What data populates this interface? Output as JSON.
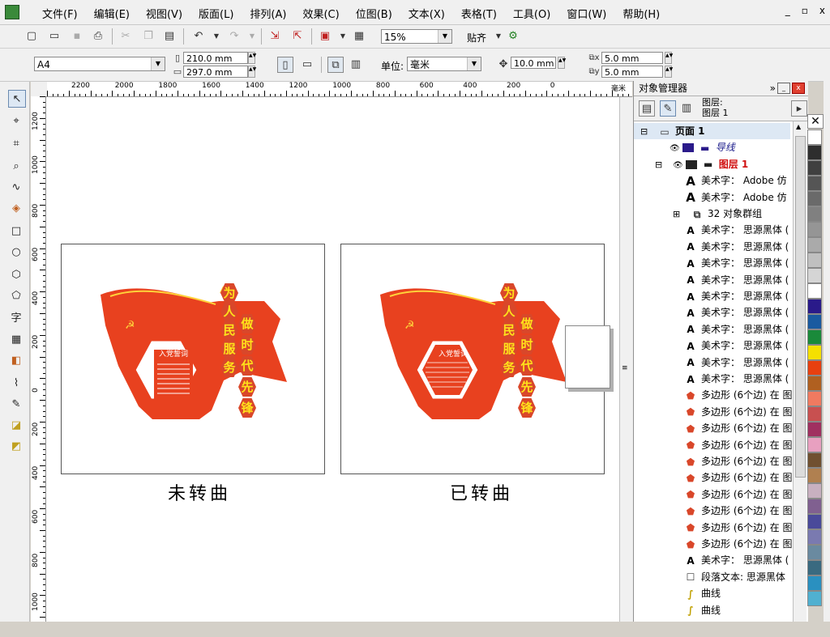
{
  "menubar": {
    "items": [
      "文件(F)",
      "编辑(E)",
      "视图(V)",
      "版面(L)",
      "排列(A)",
      "效果(C)",
      "位图(B)",
      "文本(X)",
      "表格(T)",
      "工具(O)",
      "窗口(W)",
      "帮助(H)"
    ],
    "controls": [
      "_",
      "▫",
      "x"
    ]
  },
  "toolbar": {
    "zoom": "15%",
    "snap": "贴齐"
  },
  "property_bar": {
    "page_size": "A4",
    "width": "210.0 mm",
    "height": "297.0 mm",
    "unit_label": "单位:",
    "unit": "毫米",
    "nudge": "10.0 mm",
    "dup_x": "5.0 mm",
    "dup_y": "5.0 mm",
    "x_label": "x",
    "y_label": "y"
  },
  "ruler": {
    "h_ticks": [
      "2200",
      "2000",
      "1800",
      "1600",
      "1400",
      "1200",
      "1000",
      "800",
      "600",
      "400",
      "200",
      "0"
    ],
    "h_unit": "毫米",
    "v_ticks": [
      "1200",
      "1000",
      "800",
      "600",
      "400",
      "200",
      "0",
      "200",
      "400",
      "600",
      "800",
      "1000"
    ]
  },
  "canvas": {
    "left_panel": {
      "caption": "未转曲",
      "vertical_left": [
        "为",
        "人",
        "民",
        "服",
        "务"
      ],
      "vertical_right": [
        "做",
        "时",
        "代",
        "先",
        "锋"
      ],
      "box_title": "入党誓词"
    },
    "right_panel": {
      "caption": "已转曲",
      "vertical_left": [
        "为",
        "人",
        "民",
        "服",
        "务"
      ],
      "vertical_right": [
        "做",
        "时",
        "代",
        "先",
        "锋"
      ],
      "box_title": "入党誓词"
    },
    "brand_color": "#e8411f",
    "hex_color": "#d9472a",
    "text_yellow": "#ffe21a"
  },
  "object_manager": {
    "title": "对象管理器",
    "layer_header": [
      "图层:",
      "图层 1"
    ],
    "rows": [
      {
        "text": "页面 1",
        "icon": "page-icon",
        "bold": true
      },
      {
        "text": "导线",
        "icon": "guides-layer-icon",
        "italic": true,
        "color": "#1a1a8a"
      },
      {
        "text": "图层 1",
        "icon": "layer-icon",
        "color": "#d01010",
        "bold": true
      },
      {
        "text": "美术字： Adobe 仿",
        "icon": "artistic-text-icon"
      },
      {
        "text": "美术字： Adobe 仿",
        "icon": "artistic-text-icon"
      },
      {
        "text": "32 对象群组",
        "icon": "group-icon"
      },
      {
        "text": "美术字： 思源黑体 (",
        "icon": "artistic-text-icon"
      },
      {
        "text": "美术字： 思源黑体 (",
        "icon": "artistic-text-icon"
      },
      {
        "text": "美术字： 思源黑体 (",
        "icon": "artistic-text-icon"
      },
      {
        "text": "美术字： 思源黑体 (",
        "icon": "artistic-text-icon"
      },
      {
        "text": "美术字： 思源黑体 (",
        "icon": "artistic-text-icon"
      },
      {
        "text": "美术字： 思源黑体 (",
        "icon": "artistic-text-icon"
      },
      {
        "text": "美术字： 思源黑体 (",
        "icon": "artistic-text-icon"
      },
      {
        "text": "美术字： 思源黑体 (",
        "icon": "artistic-text-icon"
      },
      {
        "text": "美术字： 思源黑体 (",
        "icon": "artistic-text-icon"
      },
      {
        "text": "美术字： 思源黑体 (",
        "icon": "artistic-text-icon"
      },
      {
        "text": "多边形 (6个边) 在 图",
        "icon": "polygon-icon"
      },
      {
        "text": "多边形 (6个边) 在 图",
        "icon": "polygon-icon"
      },
      {
        "text": "多边形 (6个边) 在 图",
        "icon": "polygon-icon"
      },
      {
        "text": "多边形 (6个边) 在 图",
        "icon": "polygon-icon"
      },
      {
        "text": "多边形 (6个边) 在 图",
        "icon": "polygon-icon"
      },
      {
        "text": "多边形 (6个边) 在 图",
        "icon": "polygon-icon"
      },
      {
        "text": "多边形 (6个边) 在 图",
        "icon": "polygon-icon"
      },
      {
        "text": "多边形 (6个边) 在 图",
        "icon": "polygon-icon"
      },
      {
        "text": "多边形 (6个边) 在 图",
        "icon": "polygon-icon"
      },
      {
        "text": "多边形 (6个边) 在 图",
        "icon": "polygon-icon"
      },
      {
        "text": "美术字： 思源黑体 (",
        "icon": "artistic-text-icon"
      },
      {
        "text": "段落文本: 思源黑体",
        "icon": "paragraph-text-icon"
      },
      {
        "text": "曲线",
        "icon": "curve-icon"
      },
      {
        "text": "曲线",
        "icon": "curve-icon"
      }
    ]
  },
  "palette": [
    "#ffffff",
    "#2e2e2e",
    "#404040",
    "#555555",
    "#6a6a6a",
    "#808080",
    "#959595",
    "#aaaaaa",
    "#c0c0c0",
    "#d5d5d5",
    "#ffffff",
    "#2a1a8a",
    "#1a5aa0",
    "#1a8a3a",
    "#f5e000",
    "#e84010",
    "#b06020",
    "#f07a60",
    "#c85050",
    "#a03060",
    "#e8a0c0",
    "#705030",
    "#b08050",
    "#c8b0c0",
    "#806090",
    "#4a4a9a",
    "#7a7ab0",
    "#6a8aa0",
    "#3a6a80",
    "#2a90c0",
    "#50b0d0"
  ]
}
